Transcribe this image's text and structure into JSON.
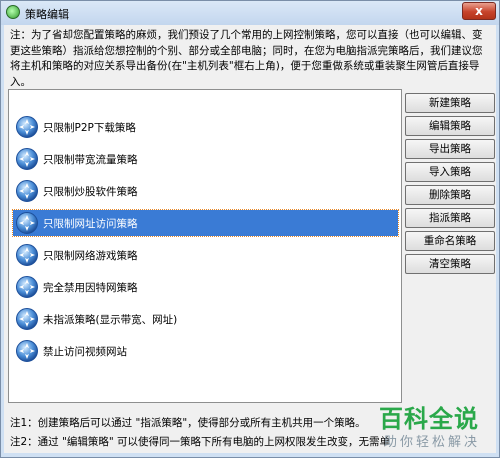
{
  "window": {
    "title": "策略编辑",
    "close_glyph": "x"
  },
  "note_top": "注：为了省却您配置策略的麻烦，我们预设了几个常用的上网控制策略，您可以直接（也可以编辑、变更这些策略）指派给您想控制的个别、部分或全部电脑；同时，在您为电脑指派完策略后，我们建议您将主机和策略的对应关系导出备份(在\"主机列表\"框右上角)，便于您重做系统或重装聚生网管后直接导入。",
  "policies": [
    {
      "label": "只限制P2P下载策略",
      "icon": "policy-icon",
      "selected": false
    },
    {
      "label": "只限制带宽流量策略",
      "icon": "policy-icon",
      "selected": false
    },
    {
      "label": "只限制炒股软件策略",
      "icon": "policy-icon",
      "selected": false
    },
    {
      "label": "只限制网址访问策略",
      "icon": "policy-icon",
      "selected": true
    },
    {
      "label": "只限制网络游戏策略",
      "icon": "policy-icon",
      "selected": false
    },
    {
      "label": "完全禁用因特网策略",
      "icon": "policy-icon",
      "selected": false
    },
    {
      "label": "未指派策略(显示带宽、网址)",
      "icon": "policy-icon",
      "selected": false
    },
    {
      "label": "禁止访问视频网站",
      "icon": "policy-icon",
      "selected": false
    }
  ],
  "buttons": {
    "new": "新建策略",
    "edit": "编辑策略",
    "export": "导出策略",
    "import": "导入策略",
    "delete": "删除策略",
    "assign": "指派策略",
    "rename": "重命名策略",
    "clear": "清空策略"
  },
  "notes_bottom": [
    "注1：创建策略后可以通过 \"指派策略\"，使得部分或所有主机共用一个策略。",
    "注2：通过 \"编辑策略\" 可以使得同一策略下所有电脑的上网权限发生改变，无需单"
  ],
  "watermark": {
    "line1": "百科全说",
    "line2": "助你轻松解决"
  },
  "colors": {
    "selection": "#3a7bd5",
    "watermark": "#2aa84a",
    "title_bar": "#c3d6ee"
  }
}
